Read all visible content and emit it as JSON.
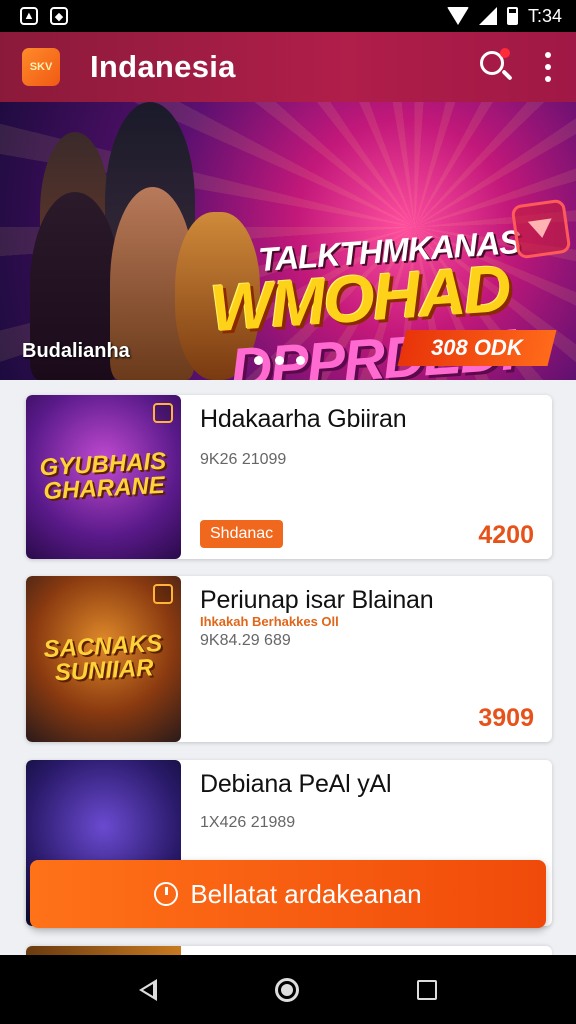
{
  "status_bar": {
    "time": "T:34",
    "icons": [
      "notification-icon",
      "notification-icon",
      "wifi-icon",
      "signal-icon",
      "battery-icon"
    ]
  },
  "app_bar": {
    "logo_text": "SKV",
    "title": "Indanesia",
    "search_icon": "search-icon",
    "menu_icon": "overflow-menu-icon"
  },
  "banner": {
    "headline_1": "TALKTHMKANAS",
    "headline_2": "WMOHAD",
    "headline_3": "DPPRDED!",
    "caption": "Budalianha",
    "cta": "308 ODK",
    "slide_count": 3
  },
  "games": [
    {
      "title": "Hdakaarha Gbiiran",
      "subtitle": "9K26 21099",
      "tag": "",
      "pill": "Shdanac",
      "price": "4200",
      "thumb_logo": "GYUBHAIS GHARANE",
      "accent": "#8a2ab0"
    },
    {
      "title": "Periunap isar Blainan",
      "subtitle": "9K84.29 689",
      "tag": "Ihkakah Berhakkes Oll",
      "pill": "",
      "price": "3909",
      "thumb_logo": "SACNAKS SUNIIAR",
      "accent": "#c85a10"
    },
    {
      "title": "Debiana PeAl yAl",
      "subtitle": "1X426 21989",
      "tag": "",
      "pill": "",
      "price": "",
      "thumb_logo": "",
      "accent": "#3a2a8a"
    }
  ],
  "fab": {
    "label": "Bellatat ardakeanan"
  },
  "nav_bar": {
    "icons": [
      "back-icon",
      "home-icon",
      "recents-icon"
    ]
  }
}
